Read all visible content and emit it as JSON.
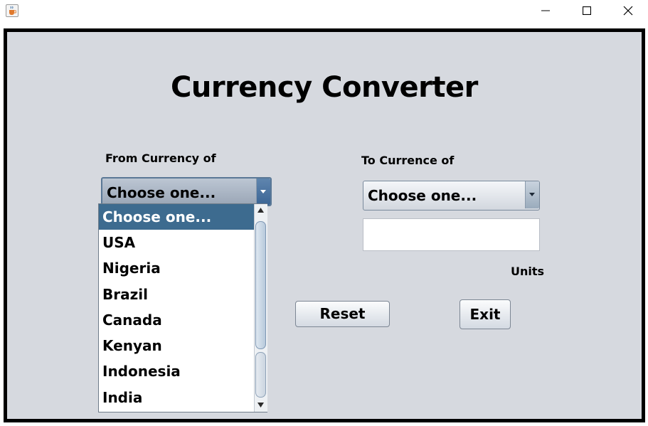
{
  "window": {
    "app_icon": "java-coffee-cup-icon",
    "controls": [
      "minimize-icon",
      "maximize-icon",
      "close-icon"
    ]
  },
  "main": {
    "title": "Currency Converter",
    "from_label": "From Currency of",
    "to_label": "To Currence of",
    "from_combo": {
      "selected": "Choose one..."
    },
    "to_combo": {
      "selected": "Choose one..."
    },
    "amount_value": "",
    "units_label": "Units",
    "reset_label": "Reset",
    "exit_label": "Exit"
  },
  "dropdown": {
    "items": [
      "Choose one...",
      "USA",
      "Nigeria",
      "Brazil",
      "Canada",
      "Kenyan",
      "Indonesia",
      "India"
    ],
    "selected_index": 0
  },
  "colors": {
    "frame_background": "#d6d9df",
    "selection": "#3d6b8f",
    "border": "#000000"
  }
}
